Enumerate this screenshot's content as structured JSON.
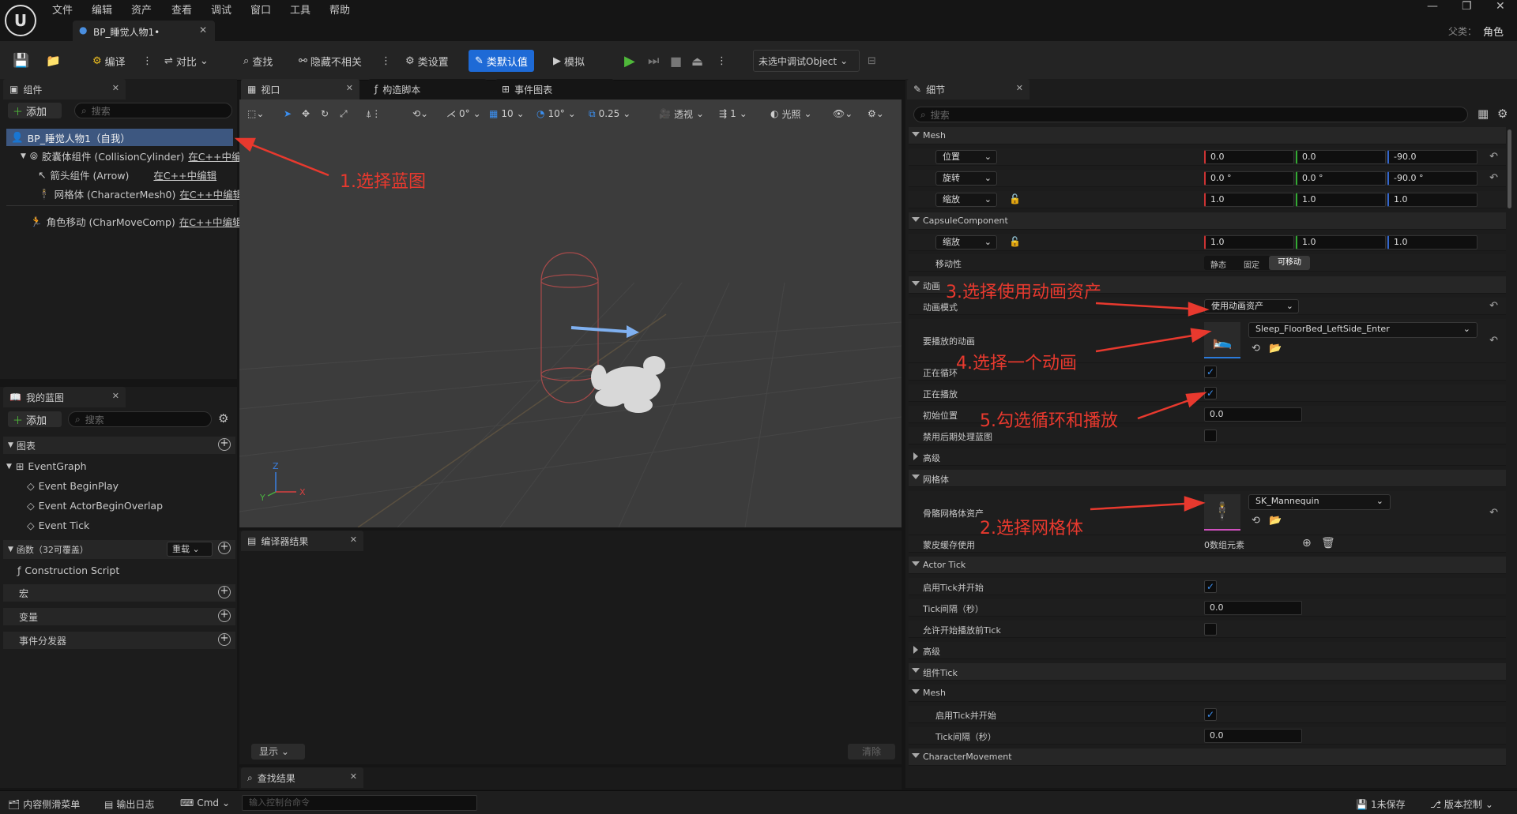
{
  "menu": [
    "文件",
    "编辑",
    "资产",
    "查看",
    "调试",
    "窗口",
    "工具",
    "帮助"
  ],
  "parent_label": "父类：",
  "parent_value": "角色",
  "doc_tab": "BP_睡觉人物1•",
  "toolbar": {
    "compile": "编译",
    "diff": "对比",
    "find": "查找",
    "hide_unrelated": "隐藏不相关",
    "class_settings": "类设置",
    "class_defaults": "类默认值",
    "simulate": "模拟",
    "debug_object": "未选中调试Object"
  },
  "components": {
    "tab": "组件",
    "add": "添加",
    "search_placeholder": "搜索",
    "root": "BP_睡觉人物1（自我）",
    "items": [
      {
        "label": "胶囊体组件 (CollisionCylinder)",
        "link": "在C++中编"
      },
      {
        "label": "箭头组件 (Arrow)",
        "link": "在C++中编辑"
      },
      {
        "label": "网格体 (CharacterMesh0)",
        "link": "在C++中编辑"
      },
      {
        "label": "角色移动 (CharMoveComp)",
        "link": "在C++中编辑"
      }
    ]
  },
  "my_blueprint": {
    "tab": "我的蓝图",
    "add": "添加",
    "search_placeholder": "搜索",
    "graphs_section": "图表",
    "event_graph": "EventGraph",
    "events": [
      "Event BeginPlay",
      "Event ActorBeginOverlap",
      "Event Tick"
    ],
    "functions_section": "函数（32可覆盖）",
    "override": "重载",
    "construction": "Construction Script",
    "macros": "宏",
    "variables": "变量",
    "dispatchers": "事件分发器"
  },
  "editor_tabs": {
    "viewport": "视口",
    "construction": "构造脚本",
    "event_graph": "事件图表"
  },
  "viewport_toolbar": {
    "rot": "0°",
    "grid": "10",
    "angle": "10°",
    "scale": "0.25",
    "perspective": "透视",
    "lighting": "光照",
    "speed": "1"
  },
  "compiler": {
    "tab": "编译器结果",
    "show": "显示",
    "clear": "清除"
  },
  "find_results": {
    "tab": "查找结果"
  },
  "details": {
    "tab": "细节",
    "search_placeholder": "搜索",
    "mesh_section": "Mesh",
    "location_label": "位置",
    "location": [
      "0.0",
      "0.0",
      "-90.0"
    ],
    "rotation_label": "旋转",
    "rotation": [
      "0.0 °",
      "0.0 °",
      "-90.0 °"
    ],
    "scale_label": "缩放",
    "scale": [
      "1.0",
      "1.0",
      "1.0"
    ],
    "capsule_section": "CapsuleComponent",
    "capsule_scale_label": "缩放",
    "capsule_scale": [
      "1.0",
      "1.0",
      "1.0"
    ],
    "mobility_label": "移动性",
    "mobility": [
      "静态",
      "固定",
      "可移动"
    ],
    "anim_section": "动画",
    "anim_mode_label": "动画模式",
    "anim_mode": "使用动画资产",
    "anim_to_play_label": "要播放的动画",
    "anim_to_play": "Sleep_FloorBed_LeftSide_Enter",
    "looping_label": "正在循环",
    "playing_label": "正在播放",
    "initial_pos_label": "初始位置",
    "initial_pos": "0.0",
    "disable_post_label": "禁用后期处理蓝图",
    "advanced": "高级",
    "mesh2_section": "网格体",
    "skeletal_label": "骨骼网格体资产",
    "skeletal": "SK_Mannequin",
    "skin_cache_label": "蒙皮缓存使用",
    "skin_cache": "0数组元素",
    "actor_tick_section": "Actor Tick",
    "tick_start_label": "启用Tick并开始",
    "tick_interval_label": "Tick间隔（秒）",
    "tick_interval": "0.0",
    "tick_before_label": "允许开始播放前Tick",
    "advanced2": "高级",
    "comp_tick_section": "组件Tick",
    "mesh3_section": "Mesh",
    "mesh_tick_start_label": "启用Tick并开始",
    "mesh_tick_interval_label": "Tick间隔（秒）",
    "mesh_tick_interval": "0.0",
    "char_move_section": "CharacterMovement"
  },
  "annotations": [
    "1.选择蓝图",
    "2.选择网格体",
    "3.选择使用动画资产",
    "4.选择一个动画",
    "5.勾选循环和播放"
  ],
  "statusbar": {
    "content_drawer": "内容侧滑菜单",
    "output_log": "输出日志",
    "cmd": "Cmd",
    "console_placeholder": "输入控制台命令",
    "unsaved": "1未保存",
    "source_control": "版本控制"
  },
  "colors": {
    "accent": "#1e6ad6",
    "play": "#4fb83a",
    "annotation": "#e8392e"
  }
}
